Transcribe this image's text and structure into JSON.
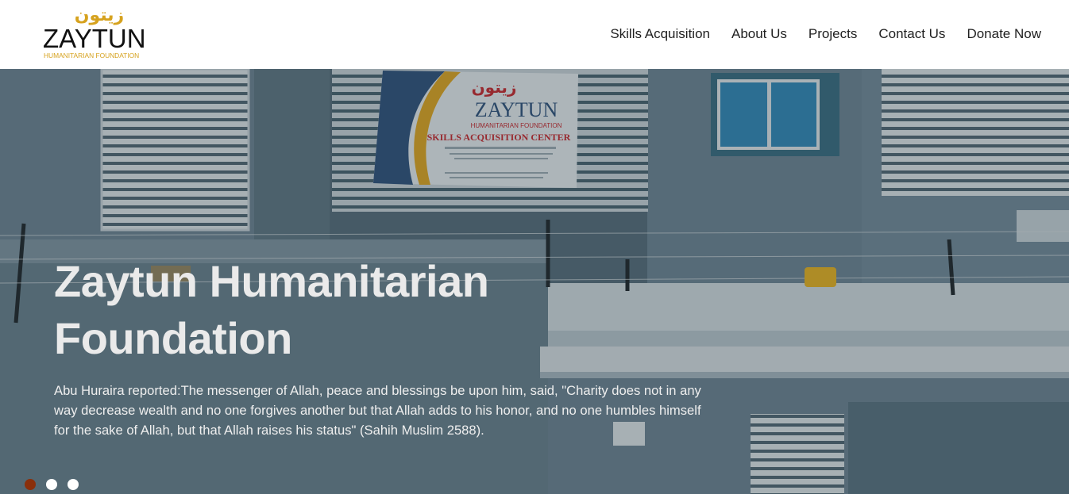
{
  "logo": {
    "arabic": "زيتون",
    "name": "ZAYTUN",
    "tagline": "HUMANITARIAN FOUNDATION"
  },
  "nav": {
    "items": [
      {
        "label": "Skills Acquisition"
      },
      {
        "label": "About Us"
      },
      {
        "label": "Projects"
      },
      {
        "label": "Contact Us"
      },
      {
        "label": "Donate Now"
      }
    ]
  },
  "hero": {
    "title": "Zaytun Humanitarian Foundation",
    "quote": "Abu Huraira reported:The messenger of Allah, peace and blessings be upon him, said, \"Charity does not in any way decrease wealth and no one forgives another but that Allah adds to his honor, and no one humbles himself for the sake of Allah, but that Allah raises his status\" (Sahih Muslim 2588).",
    "sign": {
      "arabic": "زيتون",
      "name": "ZAYTUN",
      "tagline": "HUMANITARIAN FOUNDATION",
      "center": "SKILLS ACQUISITION CENTER"
    },
    "slides": {
      "count": 3,
      "active_index": 0
    }
  },
  "colors": {
    "brand_gold": "#d6a21e",
    "active_dot": "#8a2f0b",
    "nav_text": "#1f1f1f",
    "hero_text": "#eaeaea"
  }
}
